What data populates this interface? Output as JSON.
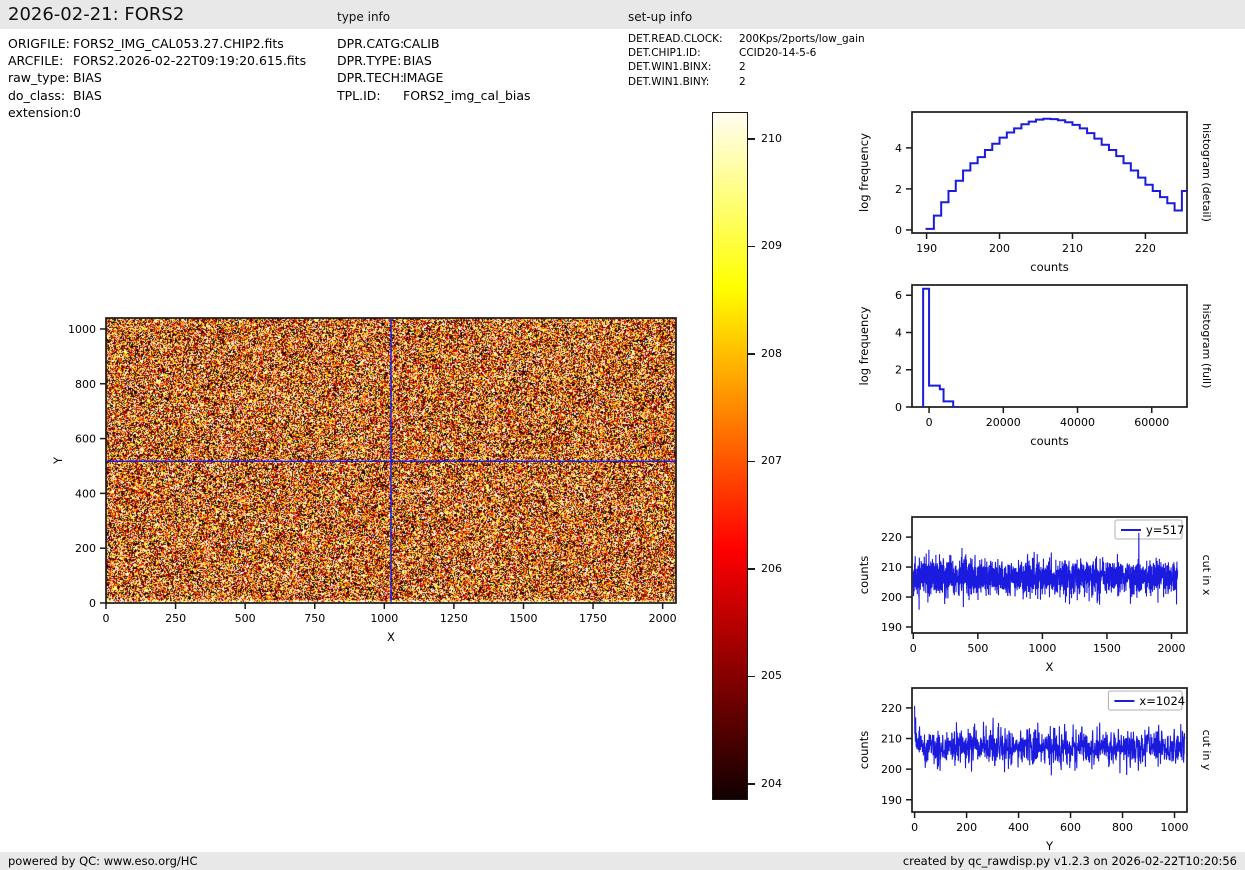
{
  "header": {
    "title": "2026-02-21: FORS2",
    "type_info_label": "type info",
    "setup_info_label": "set-up info"
  },
  "file_info": {
    "rows": [
      {
        "label": "ORIGFILE:",
        "value": "FORS2_IMG_CAL053.27.CHIP2.fits"
      },
      {
        "label": "ARCFILE:",
        "value": "FORS2.2026-02-22T09:19:20.615.fits"
      },
      {
        "label": "raw_type:",
        "value": "BIAS"
      },
      {
        "label": "do_class:",
        "value": "BIAS"
      },
      {
        "label": "extension:",
        "value": "0"
      }
    ]
  },
  "type_info": {
    "rows": [
      {
        "label": "DPR.CATG:",
        "value": "CALIB"
      },
      {
        "label": "DPR.TYPE:",
        "value": "BIAS"
      },
      {
        "label": "DPR.TECH:",
        "value": "IMAGE"
      },
      {
        "label": "TPL.ID:",
        "value": "FORS2_img_cal_bias"
      }
    ]
  },
  "setup_info": {
    "rows": [
      {
        "label": "DET.READ.CLOCK:",
        "value": "200Kps/2ports/low_gain"
      },
      {
        "label": "DET.CHIP1.ID:",
        "value": "CCID20-14-5-6"
      },
      {
        "label": "DET.WIN1.BINX:",
        "value": "2"
      },
      {
        "label": "DET.WIN1.BINY:",
        "value": "2"
      }
    ]
  },
  "footer": {
    "left": "powered by QC: www.eso.org/HC",
    "right": "created by qc_rawdisp.py v1.2.3 on 2026-02-22T10:20:56"
  },
  "colors": {
    "accent_blue": "#1b1bdf",
    "panel_gray": "#e8e8e8",
    "axis_black": "#1a1a1a"
  },
  "chart_data": [
    {
      "id": "bias_image",
      "type": "heatmap",
      "xlabel": "X",
      "ylabel": "Y",
      "xlim": [
        0,
        2048
      ],
      "ylim": [
        0,
        1040
      ],
      "xticks": [
        0,
        250,
        500,
        750,
        1000,
        1250,
        1500,
        1750,
        2000
      ],
      "yticks": [
        0,
        200,
        400,
        600,
        800,
        1000
      ],
      "colormap": "hot",
      "vmin": 203.85,
      "vmax": 210.25,
      "noise": {
        "mean": 207.0,
        "sigma": 3.1,
        "seed": 5
      },
      "crosshair": {
        "x": 1024,
        "y": 517
      },
      "bright_bottom_rows": 4
    },
    {
      "id": "colorbar",
      "type": "colorbar",
      "ticks": [
        204,
        205,
        206,
        207,
        208,
        209,
        210
      ],
      "vmin": 203.85,
      "vmax": 210.25,
      "colormap": "hot"
    },
    {
      "id": "hist_detail",
      "type": "line",
      "style": "step-histogram",
      "xlabel": "counts",
      "ylabel": "log frequency",
      "right_label": "histogram (detail)",
      "xlim": [
        188,
        225.7
      ],
      "ylim": [
        -0.15,
        5.75
      ],
      "xticks": [
        190,
        200,
        210,
        220
      ],
      "yticks": [
        0,
        2,
        4
      ],
      "bin_start": 190,
      "bin_width": 1,
      "values": [
        0.05,
        0.7,
        1.35,
        1.9,
        2.4,
        2.9,
        3.25,
        3.55,
        3.9,
        4.2,
        4.5,
        4.75,
        4.95,
        5.15,
        5.28,
        5.38,
        5.42,
        5.4,
        5.35,
        5.25,
        5.12,
        4.95,
        4.72,
        4.45,
        4.15,
        3.9,
        3.6,
        3.25,
        2.9,
        2.55,
        2.2,
        1.9,
        1.6,
        1.3,
        0.95,
        1.9
      ]
    },
    {
      "id": "hist_full",
      "type": "line",
      "style": "step-histogram",
      "xlabel": "counts",
      "ylabel": "log frequency",
      "right_label": "histogram (full)",
      "xlim": [
        -4600,
        69500
      ],
      "ylim": [
        0,
        6.55
      ],
      "xticks": [
        0,
        20000,
        40000,
        60000
      ],
      "yticks": [
        0,
        2,
        4,
        6
      ],
      "steps": [
        [
          -1600,
          6.35
        ],
        [
          0,
          1.15
        ],
        [
          2900,
          0.95
        ],
        [
          3900,
          0.3
        ],
        [
          6500,
          0
        ]
      ],
      "end": 8000
    },
    {
      "id": "cut_x",
      "type": "line",
      "style": "noise-trace",
      "xlabel": "X",
      "ylabel": "counts",
      "right_label": "cut in x",
      "legend": "y=517",
      "xlim": [
        -10,
        2120
      ],
      "ylim": [
        188,
        226.7
      ],
      "xticks": [
        0,
        500,
        1000,
        1500,
        2000
      ],
      "yticks": [
        190,
        200,
        210,
        220
      ],
      "generator": {
        "n": 2048,
        "mean": 206.7,
        "sigma": 2.9,
        "seed": 11,
        "spike_prob": 0.012,
        "spike_scale": 5
      }
    },
    {
      "id": "cut_y",
      "type": "line",
      "style": "noise-trace",
      "xlabel": "Y",
      "ylabel": "counts",
      "right_label": "cut in y",
      "legend": "x=1024",
      "xlim": [
        -10,
        1048
      ],
      "ylim": [
        186,
        226.5
      ],
      "xticks": [
        0,
        200,
        400,
        600,
        800,
        1000
      ],
      "yticks": [
        190,
        200,
        210,
        220
      ],
      "generator": {
        "n": 1040,
        "mean": 206.9,
        "sigma": 2.9,
        "seed": 23,
        "spike_prob": 0.012,
        "spike_scale": 5,
        "start_boost": 8
      }
    }
  ]
}
